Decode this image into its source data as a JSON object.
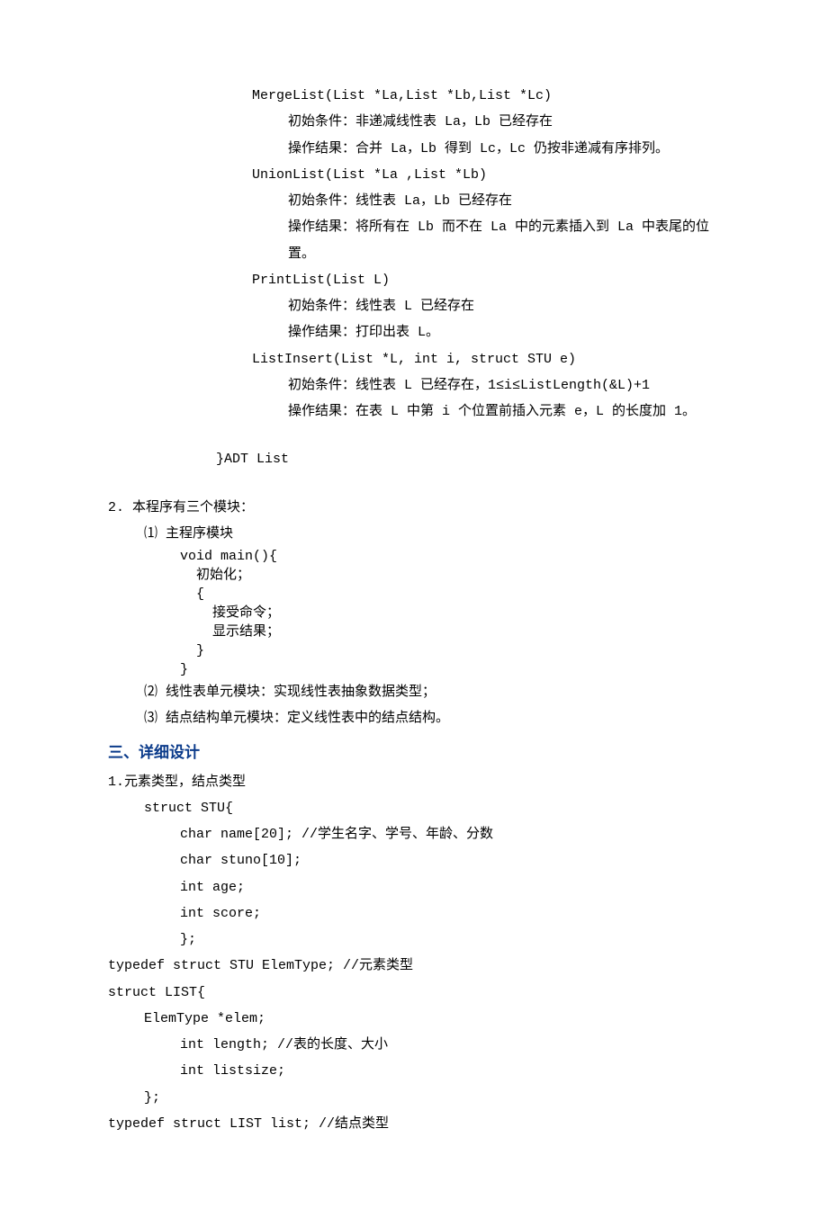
{
  "lines": {
    "l1": "MergeList(List *La,List *Lb,List *Lc)",
    "l2": "初始条件：非递减线性表 La，Lb 已经存在",
    "l3": "操作结果：合并 La，Lb 得到 Lc，Lc 仍按非递减有序排列。",
    "l4": "UnionList(List *La ,List *Lb)",
    "l5": "初始条件：线性表 La，Lb 已经存在",
    "l6": "操作结果：将所有在 Lb 而不在 La 中的元素插入到 La 中表尾的位置。",
    "l7": "PrintList(List L)",
    "l8": "初始条件：线性表 L 已经存在",
    "l9": "操作结果：打印出表 L。",
    "l10": "ListInsert(List *L, int i, struct STU e)",
    "l11": "初始条件：线性表 L 已经存在，1≤i≤ListLength(&L)+1",
    "l12": "操作结果：在表 L 中第 i 个位置前插入元素 e，L 的长度加 1。",
    "l13": "}ADT List",
    "l14": "2. 本程序有三个模块：",
    "l15": "⑴ 主程序模块",
    "l16": "void main(){\n  初始化；\n  {\n    接受命令；\n    显示结果；\n  }\n}",
    "l17": "⑵ 线性表单元模块：实现线性表抽象数据类型；",
    "l18": "⑶ 结点结构单元模块：定义线性表中的结点结构。",
    "l19": "三、详细设计",
    "l20": "1.元素类型，结点类型",
    "l21": "struct STU{",
    "l22": "char name[20];         //学生名字、学号、年龄、分数",
    "l23": "char stuno[10];",
    "l24": "int age;",
    "l25": "int score;",
    "l26": "};",
    "l27": "typedef struct STU ElemType; //元素类型",
    "l28": "struct LIST{",
    "l29": "ElemType *elem;",
    "l30": "int length;         //表的长度、大小",
    "l31": "int listsize;",
    "l32": "};",
    "l33": "typedef struct LIST list;  //结点类型"
  }
}
